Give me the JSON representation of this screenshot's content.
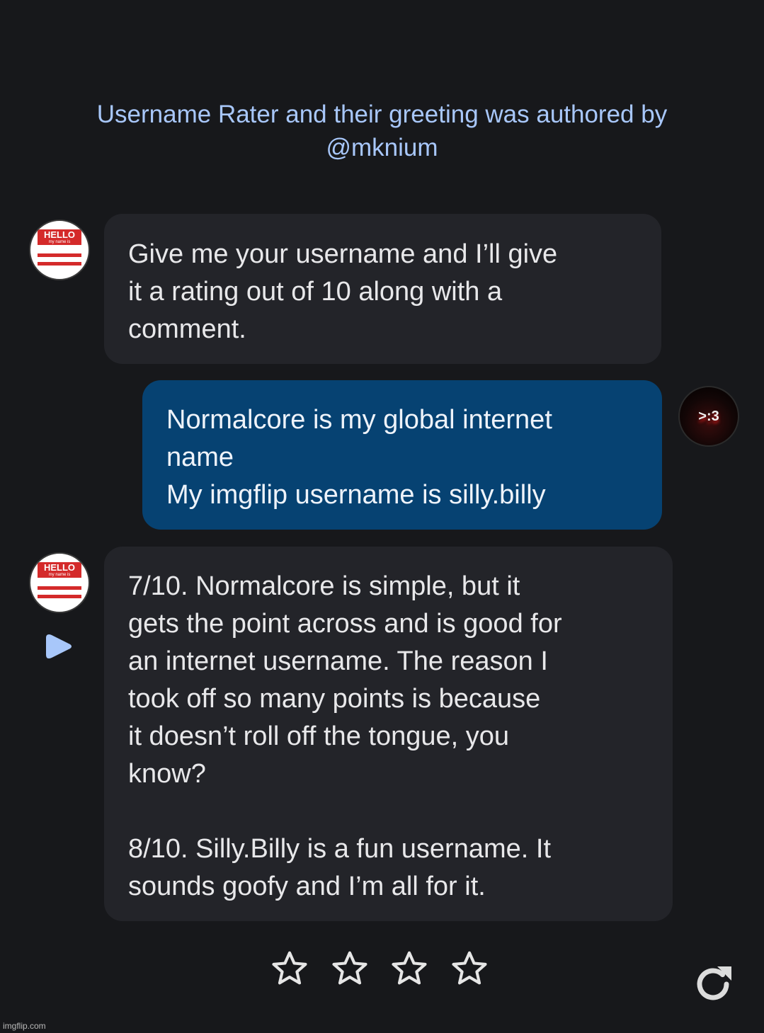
{
  "header": {
    "line1": "Username Rater and their greeting was authored by",
    "line2": "@mknium"
  },
  "bot_avatar": {
    "tag": "HELLO",
    "subtext": "my name is"
  },
  "user_avatar": {
    "text": ">:3"
  },
  "messages": [
    {
      "role": "bot",
      "text": "Give me your username and I’ll give\nit a rating out of 10 along with a\ncomment."
    },
    {
      "role": "user",
      "text": "Normalcore is my global internet\nname\nMy imgflip username is silly.billy"
    },
    {
      "role": "bot",
      "text": "7/10. Normalcore is simple, but it\ngets the point across and is good for\nan internet username. The reason I\ntook off so many points is because\nit doesn’t roll off the tongue, you\nknow?\n\n8/10. Silly.Billy is a fun username. It\nsounds goofy and I’m all for it."
    }
  ],
  "rating": {
    "stars_total": 4,
    "stars_filled": 0
  },
  "icons": {
    "play": "play-icon",
    "star": "star-outline-icon",
    "refresh": "refresh-icon"
  },
  "colors": {
    "accent": "#a8c7fa",
    "user_bubble": "#064272",
    "bot_bubble": "#232429",
    "background": "#17181b"
  },
  "watermark": "imgflip.com"
}
